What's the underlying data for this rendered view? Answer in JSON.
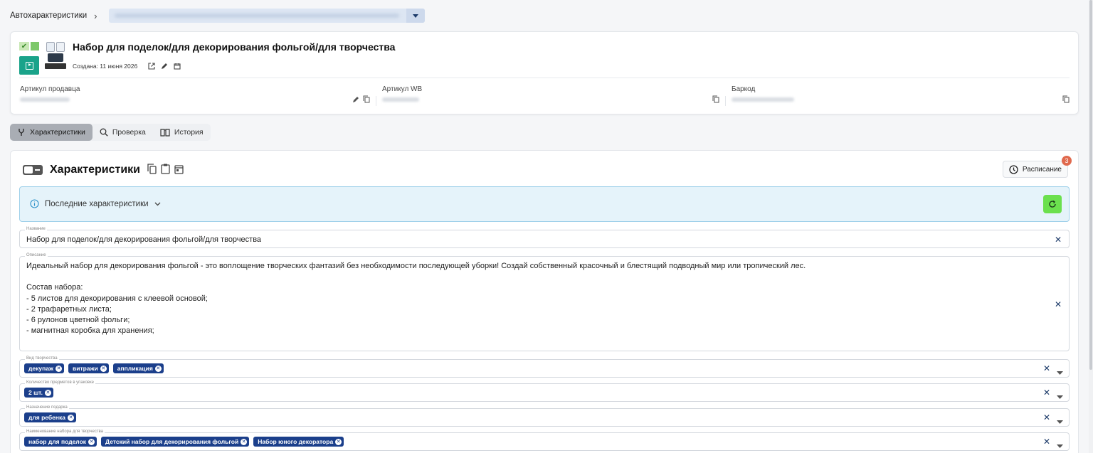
{
  "breadcrumb": {
    "root": "Автохарактеристики",
    "separator": "›"
  },
  "product": {
    "title": "Набор для поделок/для декорирования фольгой/для творчества",
    "created": "Создана: 11 июня 2026",
    "fields": [
      {
        "label": "Артикул продавца"
      },
      {
        "label": "Артикул WB"
      },
      {
        "label": "Баркод"
      }
    ]
  },
  "tabs": [
    {
      "label": "Характеристики",
      "icon": "fork-icon",
      "active": true
    },
    {
      "label": "Проверка",
      "icon": "search-icon",
      "active": false
    },
    {
      "label": "История",
      "icon": "book-icon",
      "active": false
    }
  ],
  "panel": {
    "title": "Характеристики",
    "schedule": {
      "label": "Расписание",
      "badge": "3"
    },
    "info": {
      "label": "Последние характеристики"
    },
    "name_field": {
      "label": "Название",
      "value": "Набор для поделок/для декорирования фольгой/для творчества"
    },
    "desc_field": {
      "label": "Описание",
      "value": "Идеальный набор для декорирования фольгой - это воплощение творческих фантазий без необходимости последующей уборки! Создай собственный красочный и блестящий подводный мир или тропический лес.\n\nСостав набора:\n- 5 листов для декорирования с клеевой основой;\n- 2 трафаретных листа;\n- 6 рулонов цветной фольги;\n- магнитная коробка для хранения;"
    },
    "tag_fields": [
      {
        "label": "Вид творчества",
        "chips": [
          "декупаж",
          "витражи",
          "аппликация"
        ]
      },
      {
        "label": "Количество предметов в упаковке",
        "chips": [
          "2 шт."
        ]
      },
      {
        "label": "Назначение подарка",
        "chips": [
          "для ребенка"
        ]
      },
      {
        "label": "Наименование набора для творчества",
        "chips": [
          "набор для поделок",
          "Детский набор для декорирования фольгой",
          "Набор юного декоратора"
        ]
      }
    ]
  },
  "colors": {
    "accent": "#1b3f8b",
    "play": "#1aa38a",
    "refresh": "#6be04e",
    "badge": "#e06a4e",
    "info_bg": "#e5f3fa"
  }
}
